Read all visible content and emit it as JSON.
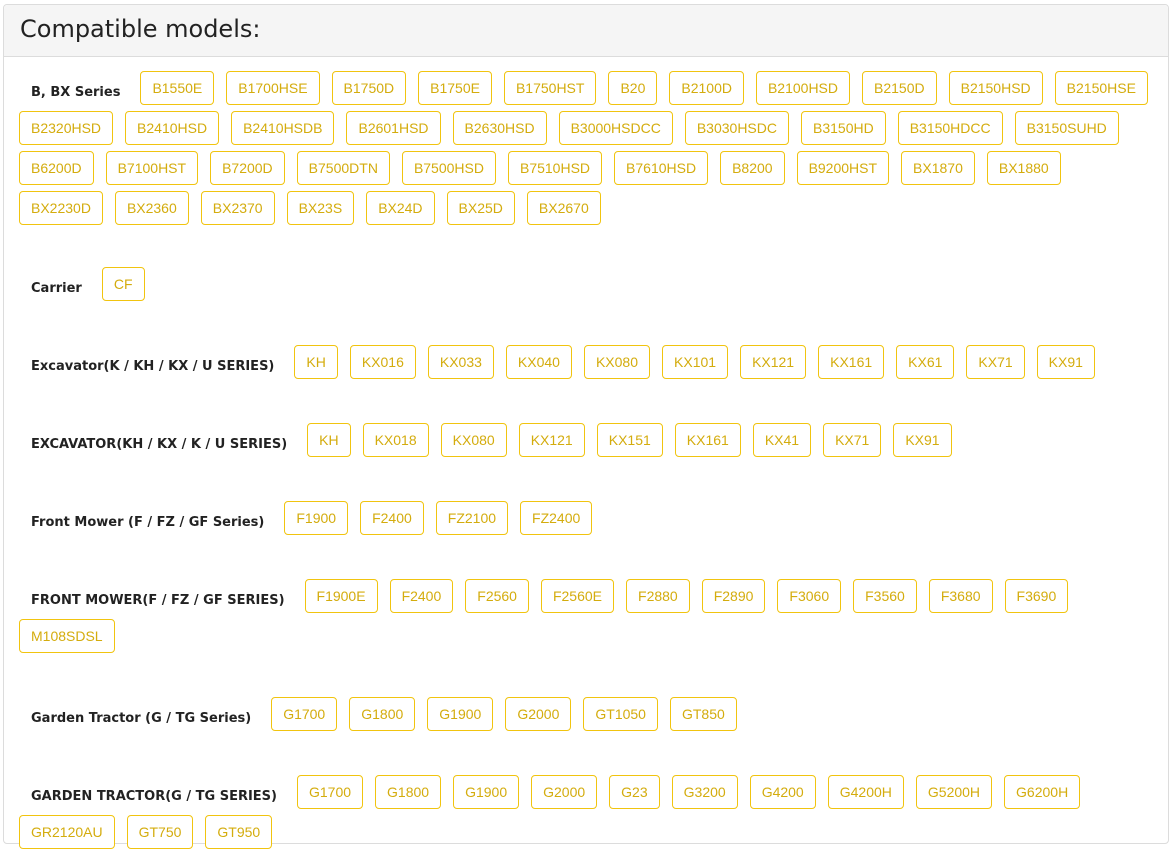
{
  "title": "Compatible models:",
  "accent_color": "#f1c40f",
  "groups": [
    {
      "label": "B, BX Series",
      "models": [
        "B1550E",
        "B1700HSE",
        "B1750D",
        "B1750E",
        "B1750HST",
        "B20",
        "B2100D",
        "B2100HSD",
        "B2150D",
        "B2150HSD",
        "B2150HSE",
        "B2320HSD",
        "B2410HSD",
        "B2410HSDB",
        "B2601HSD",
        "B2630HSD",
        "B3000HSDCC",
        "B3030HSDC",
        "B3150HD",
        "B3150HDCC",
        "B3150SUHD",
        "B6200D",
        "B7100HST",
        "B7200D",
        "B7500DTN",
        "B7500HSD",
        "B7510HSD",
        "B7610HSD",
        "B8200",
        "B9200HST",
        "BX1870",
        "BX1880",
        "BX2230D",
        "BX2360",
        "BX2370",
        "BX23S",
        "BX24D",
        "BX25D",
        "BX2670"
      ]
    },
    {
      "label": "Carrier",
      "models": [
        "CF"
      ]
    },
    {
      "label": "Excavator(K / KH / KX / U SERIES)",
      "models": [
        "KH",
        "KX016",
        "KX033",
        "KX040",
        "KX080",
        "KX101",
        "KX121",
        "KX161",
        "KX61",
        "KX71",
        "KX91"
      ]
    },
    {
      "label": "EXCAVATOR(KH / KX / K / U SERIES)",
      "models": [
        "KH",
        "KX018",
        "KX080",
        "KX121",
        "KX151",
        "KX161",
        "KX41",
        "KX71",
        "KX91"
      ]
    },
    {
      "label": "Front Mower (F / FZ / GF Series)",
      "models": [
        "F1900",
        "F2400",
        "FZ2100",
        "FZ2400"
      ]
    },
    {
      "label": "FRONT MOWER(F / FZ / GF SERIES)",
      "models": [
        "F1900E",
        "F2400",
        "F2560",
        "F2560E",
        "F2880",
        "F2890",
        "F3060",
        "F3560",
        "F3680",
        "F3690",
        "M108SDSL"
      ]
    },
    {
      "label": "Garden Tractor (G / TG Series)",
      "models": [
        "G1700",
        "G1800",
        "G1900",
        "G2000",
        "GT1050",
        "GT850"
      ]
    },
    {
      "label": "GARDEN TRACTOR(G / TG SERIES)",
      "models": [
        "G1700",
        "G1800",
        "G1900",
        "G2000",
        "G23",
        "G3200",
        "G4200",
        "G4200H",
        "G5200H",
        "G6200H",
        "GR2120AU",
        "GT750",
        "GT950"
      ]
    }
  ]
}
